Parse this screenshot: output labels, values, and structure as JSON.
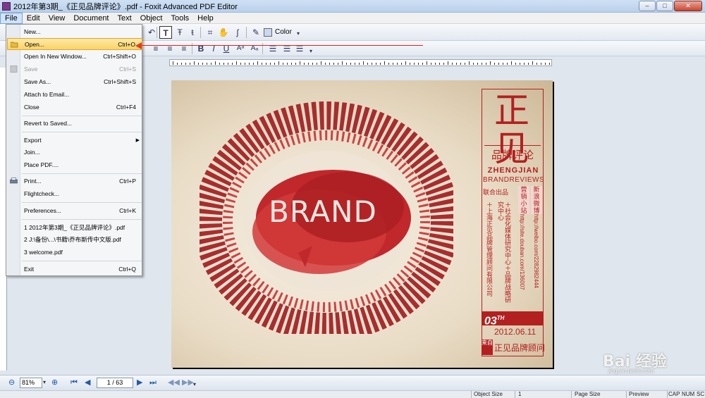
{
  "window": {
    "title": "2012年第3期_《正见品牌评论》.pdf - Foxit Advanced PDF Editor",
    "minimize": "–",
    "maximize": "□",
    "close": "✕"
  },
  "menubar": [
    "File",
    "Edit",
    "View",
    "Document",
    "Text",
    "Object",
    "Tools",
    "Help"
  ],
  "toolbar": {
    "color_label": "Color"
  },
  "file_menu": {
    "items": [
      {
        "label": "New...",
        "shortcut": ""
      },
      {
        "label": "Open...",
        "shortcut": "Ctrl+O"
      },
      {
        "label": "Open In New Window...",
        "shortcut": "Ctrl+Shift+O"
      },
      {
        "label": "Save",
        "shortcut": "Ctrl+S"
      },
      {
        "label": "Save As...",
        "shortcut": "Ctrl+Shift+S"
      },
      {
        "label": "Attach to Email...",
        "shortcut": ""
      },
      {
        "label": "Close",
        "shortcut": "Ctrl+F4"
      },
      {
        "label": "Revert to Saved...",
        "shortcut": ""
      },
      {
        "label": "Export",
        "shortcut": ""
      },
      {
        "label": "Join...",
        "shortcut": ""
      },
      {
        "label": "Place PDF....",
        "shortcut": ""
      },
      {
        "label": "Print...",
        "shortcut": "Ctrl+P"
      },
      {
        "label": "Flightcheck...",
        "shortcut": ""
      },
      {
        "label": "Preferences...",
        "shortcut": "Ctrl+K"
      },
      {
        "label": "1 2012年第3期_《正见品牌评论》.pdf",
        "shortcut": ""
      },
      {
        "label": "2 J:\\备份\\...\\书籍\\乔布斯传中文版.pdf",
        "shortcut": ""
      },
      {
        "label": "3 welcome.pdf",
        "shortcut": ""
      },
      {
        "label": "Exit",
        "shortcut": "Ctrl+Q"
      }
    ],
    "highlighted": "Open...",
    "disabled": [
      "Save"
    ]
  },
  "document": {
    "brand_word": "BRAND",
    "big_title": "正见",
    "sub_title": "品牌评论",
    "en_title_1": "ZHENGJIAN",
    "en_title_2": "BRANDREVIEWS",
    "col_labels": [
      "联合出品",
      "营销小站",
      "新浪微博"
    ],
    "col_text_1": "＋上海正见品牌管理顾问有限公司",
    "col_text_2": "＋社会化媒体研究中心＋品牌战略研究中心",
    "col_text_3": "http://site.douban.com/136007",
    "col_text_4": "http://weibo.com/2282982444",
    "issue_number": "03",
    "issue_suffix": "TH",
    "issue_date": "2012.06.11",
    "footer_tag": "来自",
    "footer_brand": "正见品牌顾问"
  },
  "navbar": {
    "zoom": "81%",
    "page": "1 / 63"
  },
  "statusbar": {
    "object_size": "Object Size",
    "object_value": "1",
    "page_size": "Page Size",
    "preview": "Preview",
    "cap": "CAP",
    "num": "NUM",
    "scrl": "SC"
  },
  "watermark": {
    "logo": "Bai 经验",
    "url": "jingyan.baidu.com"
  },
  "colors": {
    "brand_red": "#b32020",
    "menu_highlight": "#f8d467",
    "annotation_red": "#d22222"
  }
}
